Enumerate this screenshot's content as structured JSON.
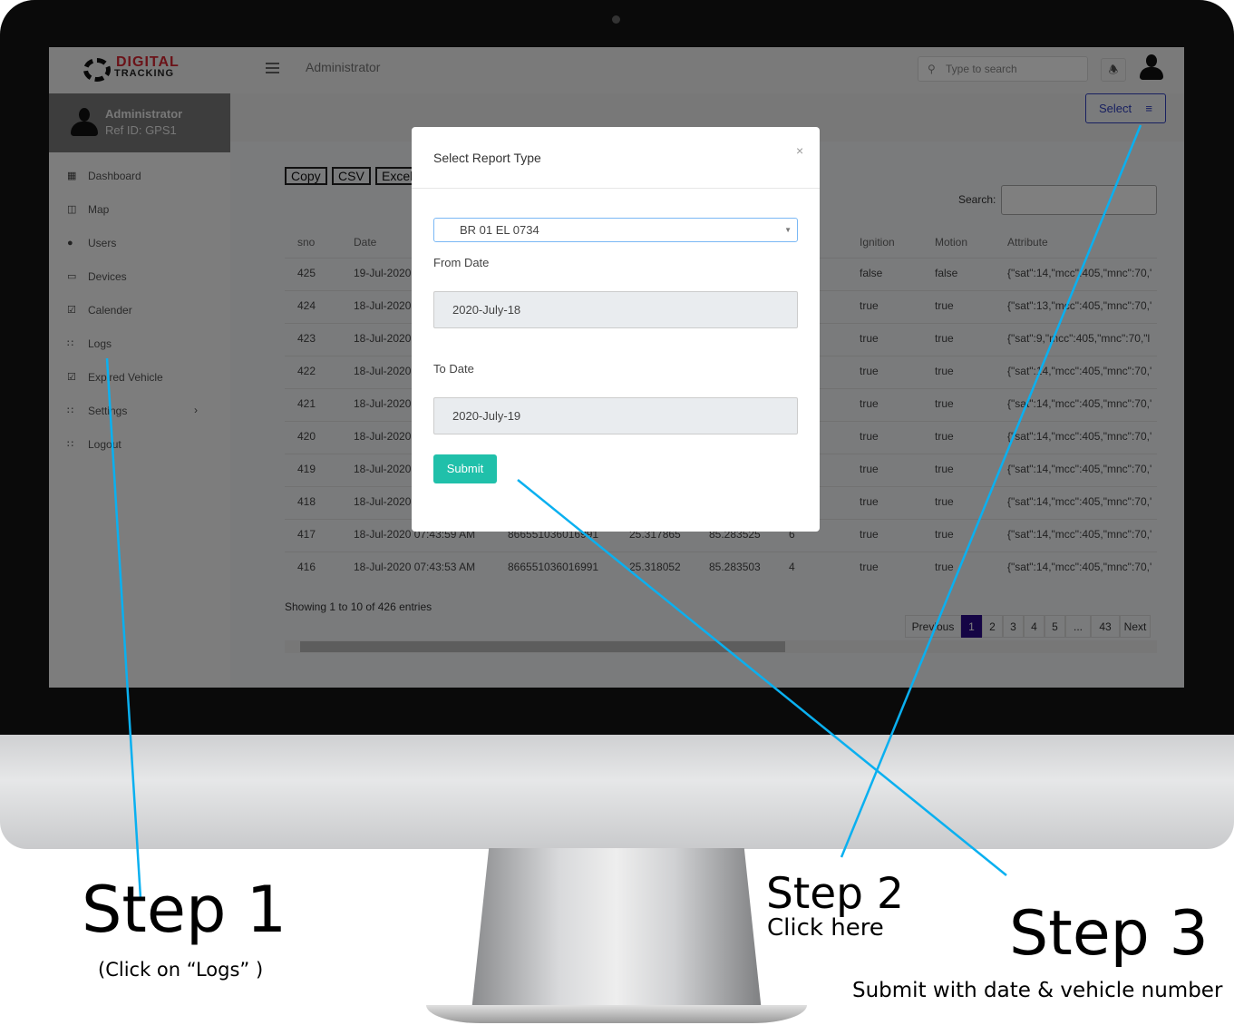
{
  "header": {
    "logo_top": "DIGITAL",
    "logo_bottom": "TRACKING",
    "title": "Administrator",
    "search_placeholder": "Type to search"
  },
  "profile": {
    "name": "Administrator",
    "ref": "Ref ID: GPS1"
  },
  "sidebar": {
    "items": [
      {
        "label": "Dashboard",
        "icon": "dashboard-icon"
      },
      {
        "label": "Map",
        "icon": "map-icon"
      },
      {
        "label": "Users",
        "icon": "user-icon"
      },
      {
        "label": "Devices",
        "icon": "monitor-icon"
      },
      {
        "label": "Calender",
        "icon": "calendar-icon"
      },
      {
        "label": "Logs",
        "icon": "grid-icon"
      },
      {
        "label": "Expired Vehicle",
        "icon": "calendar-icon"
      },
      {
        "label": "Settings",
        "icon": "grid-icon"
      },
      {
        "label": "Logout",
        "icon": "grid-icon"
      }
    ]
  },
  "toolbar": {
    "select": "Select",
    "copy": "Copy",
    "csv": "CSV",
    "excel": "Excel",
    "search_label": "Search:"
  },
  "table": {
    "headers": {
      "sno": "sno",
      "date": "Date",
      "ignition": "Ignition",
      "motion": "Motion",
      "attribute": "Attribute"
    },
    "rows": [
      {
        "sno": "425",
        "date": "19-Jul-2020",
        "imei": "",
        "lat": "",
        "lng": "",
        "sat": "",
        "ignition": "false",
        "motion": "false",
        "attribute": "{\"sat\":14,\"mcc\":405,\"mnc\":70,'"
      },
      {
        "sno": "424",
        "date": "18-Jul-2020",
        "imei": "",
        "lat": "",
        "lng": "",
        "sat": "",
        "ignition": "true",
        "motion": "true",
        "attribute": "{\"sat\":13,\"mcc\":405,\"mnc\":70,'"
      },
      {
        "sno": "423",
        "date": "18-Jul-2020",
        "imei": "",
        "lat": "",
        "lng": "",
        "sat": "",
        "ignition": "true",
        "motion": "true",
        "attribute": "{\"sat\":9,\"mcc\":405,\"mnc\":70,\"l"
      },
      {
        "sno": "422",
        "date": "18-Jul-2020",
        "imei": "",
        "lat": "",
        "lng": "",
        "sat": "",
        "ignition": "true",
        "motion": "true",
        "attribute": "{\"sat\":14,\"mcc\":405,\"mnc\":70,'"
      },
      {
        "sno": "421",
        "date": "18-Jul-2020",
        "imei": "",
        "lat": "",
        "lng": "",
        "sat": "",
        "ignition": "true",
        "motion": "true",
        "attribute": "{\"sat\":14,\"mcc\":405,\"mnc\":70,'"
      },
      {
        "sno": "420",
        "date": "18-Jul-2020",
        "imei": "",
        "lat": "",
        "lng": "",
        "sat": "",
        "ignition": "true",
        "motion": "true",
        "attribute": "{\"sat\":14,\"mcc\":405,\"mnc\":70,'"
      },
      {
        "sno": "419",
        "date": "18-Jul-2020",
        "imei": "",
        "lat": "",
        "lng": "",
        "sat": "",
        "ignition": "true",
        "motion": "true",
        "attribute": "{\"sat\":14,\"mcc\":405,\"mnc\":70,'"
      },
      {
        "sno": "418",
        "date": "18-Jul-2020",
        "imei": "",
        "lat": "",
        "lng": "",
        "sat": "",
        "ignition": "true",
        "motion": "true",
        "attribute": "{\"sat\":14,\"mcc\":405,\"mnc\":70,'"
      },
      {
        "sno": "417",
        "date": "18-Jul-2020 07:43:59 AM",
        "imei": "866551036016991",
        "lat": "25.317865",
        "lng": "85.283525",
        "sat": "6",
        "ignition": "true",
        "motion": "true",
        "attribute": "{\"sat\":14,\"mcc\":405,\"mnc\":70,'"
      },
      {
        "sno": "416",
        "date": "18-Jul-2020 07:43:53 AM",
        "imei": "866551036016991",
        "lat": "25.318052",
        "lng": "85.283503",
        "sat": "4",
        "ignition": "true",
        "motion": "true",
        "attribute": "{\"sat\":14,\"mcc\":405,\"mnc\":70,'"
      }
    ],
    "info": "Showing 1 to 10 of 426 entries"
  },
  "pagination": {
    "previous": "Previous",
    "pages": [
      "1",
      "2",
      "3",
      "4",
      "5",
      "...",
      "43"
    ],
    "next": "Next",
    "active": "1",
    "active_color": "#2a0a8a"
  },
  "modal": {
    "title": "Select Report Type",
    "close": "×",
    "vehicle": "BR 01 EL 0734",
    "from_label": "From Date",
    "from_value": "2020-July-18",
    "to_label": "To Date",
    "to_value": "2020-July-19",
    "submit": "Submit",
    "submit_color": "#20c0aa"
  },
  "annotations": {
    "step1": "Step 1",
    "step1_sub": "(Click on “Logs” )",
    "step2": "Step 2",
    "step2_sub": "Click here",
    "step3": "Step 3",
    "step3_sub": "Submit with date & vehicle number",
    "line_color": "#0ab0f0"
  }
}
